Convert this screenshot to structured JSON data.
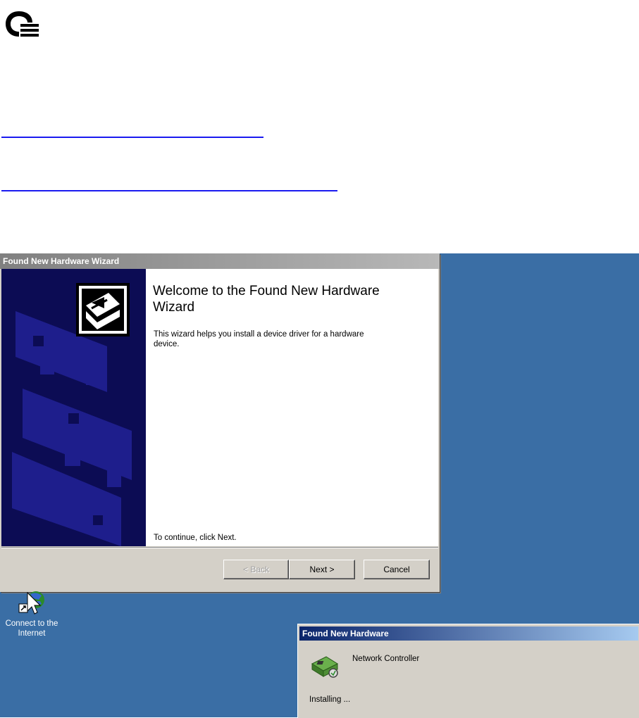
{
  "wizard": {
    "title": "Found New Hardware Wizard",
    "heading": "Welcome to the Found New Hardware Wizard",
    "description": "This wizard helps you install a device driver for a hardware device.",
    "continue_text": "To continue, click Next.",
    "back_label": "< Back",
    "next_label": "Next >",
    "cancel_label": "Cancel"
  },
  "desktop_icon": {
    "label": "Connect to the Internet"
  },
  "popup": {
    "title": "Found New Hardware",
    "device": "Network Controller",
    "status": "Installing ..."
  },
  "colors": {
    "desktop": "#3a6ea5",
    "wizard_sidebar": "#0c0c54",
    "link": "#1a1af0",
    "active_title": "#0a246a"
  }
}
